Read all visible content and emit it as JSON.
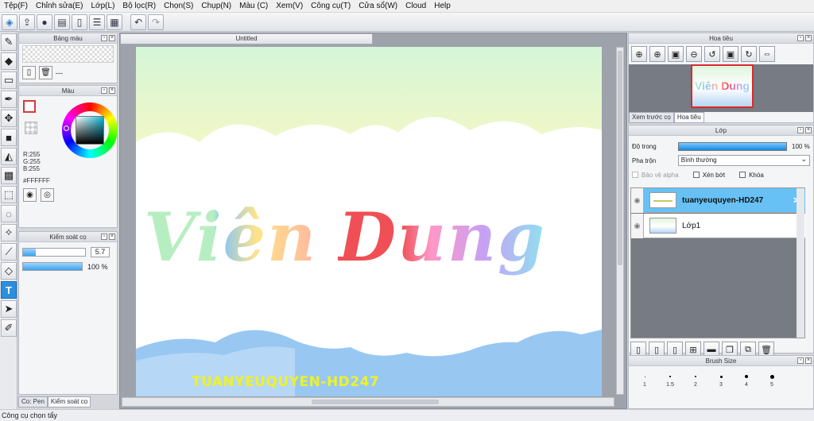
{
  "menu": [
    "Tệp(F)",
    "Chỉnh sửa(E)",
    "Lớp(L)",
    "Bộ lọc(R)",
    "Chọn(S)",
    "Chụp(N)",
    "Màu (C)",
    "Xem(V)",
    "Công cụ(T)",
    "Cửa sổ(W)",
    "Cloud",
    "Help"
  ],
  "toolbar_icons": [
    "wand-icon",
    "export-icon",
    "chat-icon",
    "comment-icon",
    "document-icon",
    "layers-icon",
    "grid-icon",
    "undo-icon",
    "redo-icon"
  ],
  "tools": [
    "brush-icon",
    "eraser-icon",
    "select-rect-icon",
    "pen-icon",
    "move-icon",
    "shape-icon",
    "bucket-icon",
    "gradient-icon",
    "lasso-rect-icon",
    "lasso-icon",
    "magic-wand-icon",
    "ruler-icon",
    "eraser2-icon",
    "text-icon",
    "select-arrow-icon",
    "dropper-icon"
  ],
  "swatch_panel": {
    "title": "Bảng màu",
    "dash": "---"
  },
  "color_panel": {
    "title": "Màu",
    "r": "R:255",
    "g": "G:255",
    "b": "B:255",
    "hex": "#FFFFFF"
  },
  "brush_control": {
    "title": "Kiểm soát cọ",
    "size": "5.7",
    "opacity": "100 %",
    "size_fraction": 0.2,
    "opacity_fraction": 1.0
  },
  "left_tabs": [
    "Co: Pen",
    "Kiểm soát cọ"
  ],
  "document": {
    "tab_title": "Untitled"
  },
  "artwork": {
    "title_word1": "Viên",
    "title_word2": "Dung",
    "watermark": "TUANYEUQUYEN-HD247",
    "colors": {
      "v": "#b7eec1",
      "i": "#86c6f4",
      "e": "#ffe38a",
      "n": "#ffb7a0",
      "d": "#ef4f55",
      "u": "#ff98c7",
      "n2": "#c7a0f3",
      "g": "#8fe2f0",
      "watermark": "#eef227",
      "sky_bottom": "#98c8f2"
    }
  },
  "navigator": {
    "title": "Hoa tiêu",
    "tabs": [
      "Xem trước cọ",
      "Hoa tiêu"
    ],
    "preview_text": "Viên Dung"
  },
  "layer_panel": {
    "title": "Lớp",
    "opacity_label": "Độ trong",
    "opacity_value": "100 %",
    "blend_label": "Pha trộn",
    "blend_value": "Bình thường",
    "protect_alpha": "Bảo vệ alpha",
    "clip": "Xén bớt",
    "lock": "Khóa",
    "layers": [
      {
        "name": "tuanyeuquyen-HD247",
        "selected": true
      },
      {
        "name": "Lớp1",
        "selected": false
      }
    ]
  },
  "brush_size": {
    "title": "Brush Size",
    "sizes": [
      "1",
      "1.5",
      "2",
      "3",
      "4",
      "5"
    ]
  },
  "status": "Công cụ chọn tẩy"
}
